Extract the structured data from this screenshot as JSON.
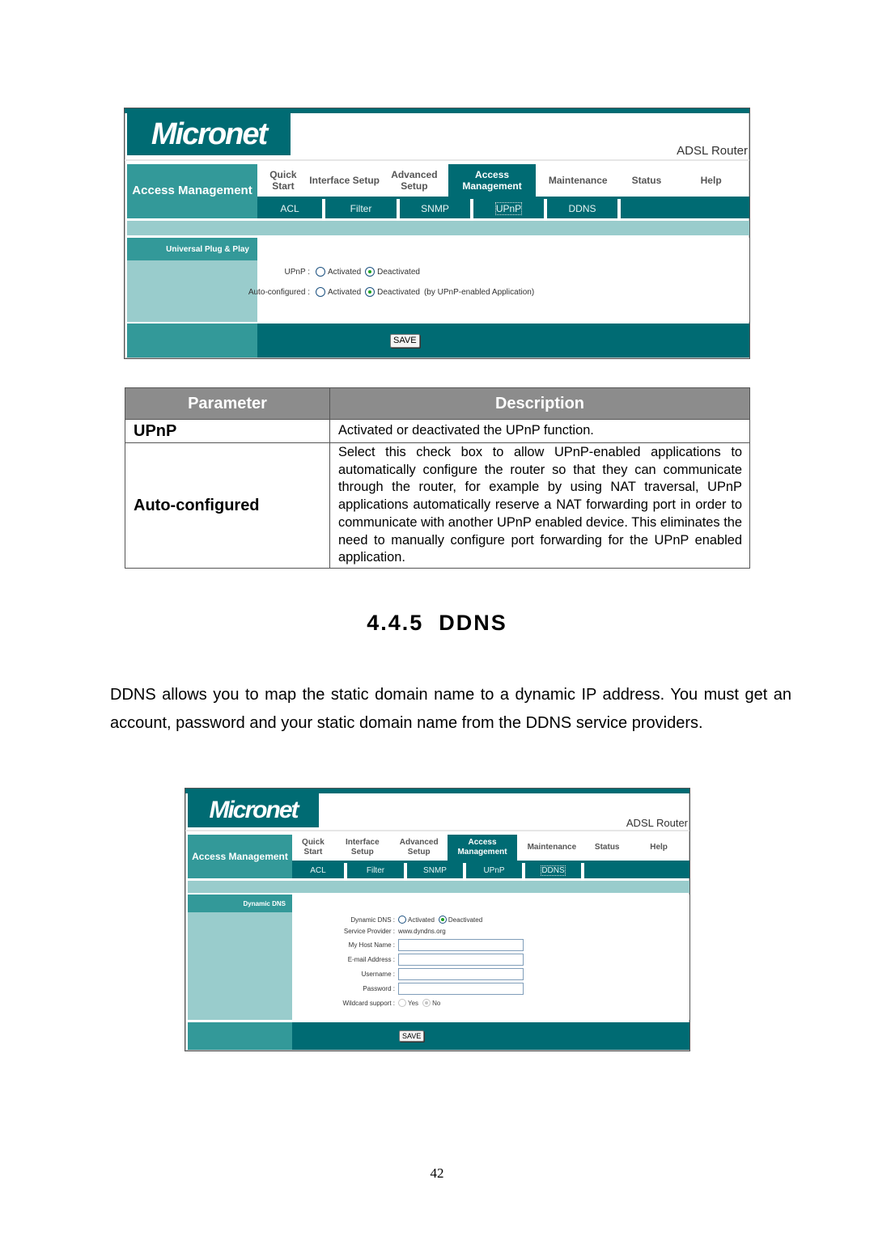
{
  "colors": {
    "brand_dark": "#006b73",
    "brand_mid": "#339999",
    "brand_light": "#99cccc",
    "table_header": "#8c8c8c",
    "radio_checked": "#21a121"
  },
  "router_common": {
    "logo": "Micronet",
    "product": "ADSL Router",
    "section_title": "Access Management",
    "main_nav": [
      {
        "label": "Quick Start",
        "active": false
      },
      {
        "label": "Interface Setup",
        "active": false
      },
      {
        "label": "Advanced Setup",
        "active": false
      },
      {
        "label": "Access Management",
        "active": true
      },
      {
        "label": "Maintenance",
        "active": false
      },
      {
        "label": "Status",
        "active": false
      },
      {
        "label": "Help",
        "active": false
      }
    ],
    "sub_nav": [
      "ACL",
      "Filter",
      "SNMP",
      "UPnP",
      "DDNS"
    ],
    "save_label": "SAVE"
  },
  "upnp_screen": {
    "focused_sub_nav": "UPnP",
    "side_title": "Universal Plug & Play",
    "fields": [
      {
        "label": "UPnP :",
        "options": [
          "Activated",
          "Deactivated"
        ],
        "selected": "Deactivated",
        "note": ""
      },
      {
        "label": "Auto-configured :",
        "options": [
          "Activated",
          "Deactivated"
        ],
        "selected": "Deactivated",
        "note": "(by UPnP-enabled Application)"
      }
    ]
  },
  "param_table": {
    "headers": [
      "Parameter",
      "Description"
    ],
    "rows": [
      {
        "parameter": "UPnP",
        "description": "Activated or deactivated the UPnP function."
      },
      {
        "parameter": "Auto-configured",
        "description": "Select this check box to allow UPnP-enabled applications to automatically configure the router so that they can communicate through the router, for example by using NAT traversal, UPnP applications automatically reserve a NAT forwarding port in order to communicate with another UPnP enabled device. This eliminates the need to manually configure port forwarding for the UPnP enabled application."
      }
    ]
  },
  "section": {
    "heading": "4.4.5  DDNS",
    "paragraph": "DDNS allows you to map the static domain name to a dynamic IP address. You must get an account, password and your static domain name from the DDNS service providers."
  },
  "ddns_screen": {
    "focused_sub_nav": "DDNS",
    "side_title": "Dynamic DNS",
    "dynamic_dns": {
      "label": "Dynamic DNS :",
      "options": [
        "Activated",
        "Deactivated"
      ],
      "selected": "Deactivated"
    },
    "service_provider": {
      "label": "Service Provider :",
      "value": "www.dyndns.org"
    },
    "inputs": [
      {
        "label": "My Host Name :",
        "value": ""
      },
      {
        "label": "E-mail Address :",
        "value": ""
      },
      {
        "label": "Username :",
        "value": ""
      },
      {
        "label": "Password :",
        "value": ""
      }
    ],
    "wildcard": {
      "label": "Wildcard support :",
      "options": [
        "Yes",
        "No"
      ],
      "selected": "No",
      "disabled": true
    }
  },
  "page_number": "42"
}
